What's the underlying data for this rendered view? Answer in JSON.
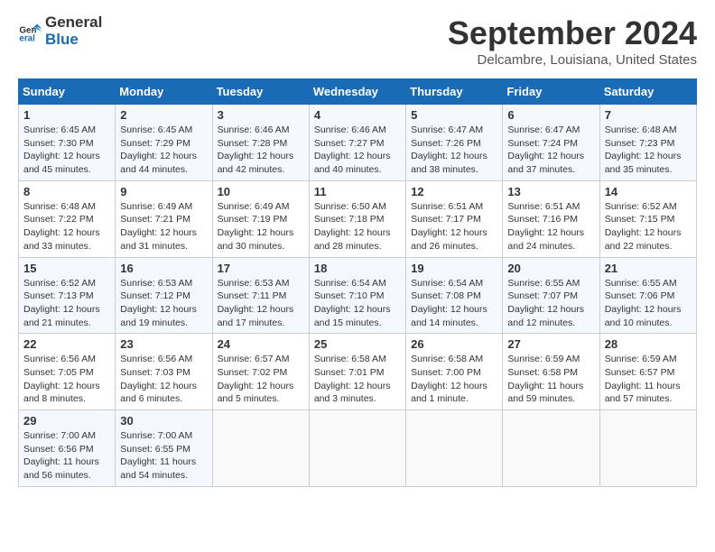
{
  "header": {
    "logo_line1": "General",
    "logo_line2": "Blue",
    "month": "September 2024",
    "location": "Delcambre, Louisiana, United States"
  },
  "weekdays": [
    "Sunday",
    "Monday",
    "Tuesday",
    "Wednesday",
    "Thursday",
    "Friday",
    "Saturday"
  ],
  "weeks": [
    [
      {
        "day": 1,
        "sunrise": "6:45 AM",
        "sunset": "7:30 PM",
        "daylight": "12 hours and 45 minutes."
      },
      {
        "day": 2,
        "sunrise": "6:45 AM",
        "sunset": "7:29 PM",
        "daylight": "12 hours and 44 minutes."
      },
      {
        "day": 3,
        "sunrise": "6:46 AM",
        "sunset": "7:28 PM",
        "daylight": "12 hours and 42 minutes."
      },
      {
        "day": 4,
        "sunrise": "6:46 AM",
        "sunset": "7:27 PM",
        "daylight": "12 hours and 40 minutes."
      },
      {
        "day": 5,
        "sunrise": "6:47 AM",
        "sunset": "7:26 PM",
        "daylight": "12 hours and 38 minutes."
      },
      {
        "day": 6,
        "sunrise": "6:47 AM",
        "sunset": "7:24 PM",
        "daylight": "12 hours and 37 minutes."
      },
      {
        "day": 7,
        "sunrise": "6:48 AM",
        "sunset": "7:23 PM",
        "daylight": "12 hours and 35 minutes."
      }
    ],
    [
      {
        "day": 8,
        "sunrise": "6:48 AM",
        "sunset": "7:22 PM",
        "daylight": "12 hours and 33 minutes."
      },
      {
        "day": 9,
        "sunrise": "6:49 AM",
        "sunset": "7:21 PM",
        "daylight": "12 hours and 31 minutes."
      },
      {
        "day": 10,
        "sunrise": "6:49 AM",
        "sunset": "7:19 PM",
        "daylight": "12 hours and 30 minutes."
      },
      {
        "day": 11,
        "sunrise": "6:50 AM",
        "sunset": "7:18 PM",
        "daylight": "12 hours and 28 minutes."
      },
      {
        "day": 12,
        "sunrise": "6:51 AM",
        "sunset": "7:17 PM",
        "daylight": "12 hours and 26 minutes."
      },
      {
        "day": 13,
        "sunrise": "6:51 AM",
        "sunset": "7:16 PM",
        "daylight": "12 hours and 24 minutes."
      },
      {
        "day": 14,
        "sunrise": "6:52 AM",
        "sunset": "7:15 PM",
        "daylight": "12 hours and 22 minutes."
      }
    ],
    [
      {
        "day": 15,
        "sunrise": "6:52 AM",
        "sunset": "7:13 PM",
        "daylight": "12 hours and 21 minutes."
      },
      {
        "day": 16,
        "sunrise": "6:53 AM",
        "sunset": "7:12 PM",
        "daylight": "12 hours and 19 minutes."
      },
      {
        "day": 17,
        "sunrise": "6:53 AM",
        "sunset": "7:11 PM",
        "daylight": "12 hours and 17 minutes."
      },
      {
        "day": 18,
        "sunrise": "6:54 AM",
        "sunset": "7:10 PM",
        "daylight": "12 hours and 15 minutes."
      },
      {
        "day": 19,
        "sunrise": "6:54 AM",
        "sunset": "7:08 PM",
        "daylight": "12 hours and 14 minutes."
      },
      {
        "day": 20,
        "sunrise": "6:55 AM",
        "sunset": "7:07 PM",
        "daylight": "12 hours and 12 minutes."
      },
      {
        "day": 21,
        "sunrise": "6:55 AM",
        "sunset": "7:06 PM",
        "daylight": "12 hours and 10 minutes."
      }
    ],
    [
      {
        "day": 22,
        "sunrise": "6:56 AM",
        "sunset": "7:05 PM",
        "daylight": "12 hours and 8 minutes."
      },
      {
        "day": 23,
        "sunrise": "6:56 AM",
        "sunset": "7:03 PM",
        "daylight": "12 hours and 6 minutes."
      },
      {
        "day": 24,
        "sunrise": "6:57 AM",
        "sunset": "7:02 PM",
        "daylight": "12 hours and 5 minutes."
      },
      {
        "day": 25,
        "sunrise": "6:58 AM",
        "sunset": "7:01 PM",
        "daylight": "12 hours and 3 minutes."
      },
      {
        "day": 26,
        "sunrise": "6:58 AM",
        "sunset": "7:00 PM",
        "daylight": "12 hours and 1 minute."
      },
      {
        "day": 27,
        "sunrise": "6:59 AM",
        "sunset": "6:58 PM",
        "daylight": "11 hours and 59 minutes."
      },
      {
        "day": 28,
        "sunrise": "6:59 AM",
        "sunset": "6:57 PM",
        "daylight": "11 hours and 57 minutes."
      }
    ],
    [
      {
        "day": 29,
        "sunrise": "7:00 AM",
        "sunset": "6:56 PM",
        "daylight": "11 hours and 56 minutes."
      },
      {
        "day": 30,
        "sunrise": "7:00 AM",
        "sunset": "6:55 PM",
        "daylight": "11 hours and 54 minutes."
      },
      null,
      null,
      null,
      null,
      null
    ]
  ]
}
